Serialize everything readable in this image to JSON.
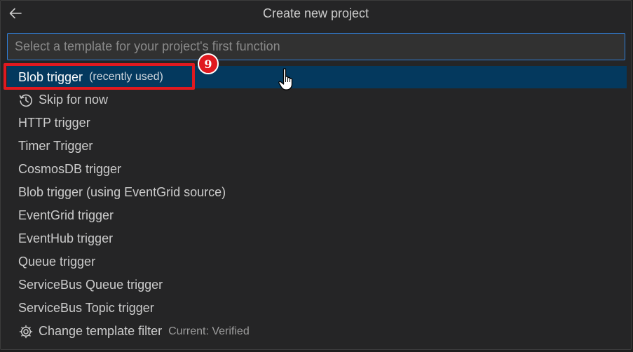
{
  "header": {
    "title": "Create new project"
  },
  "search": {
    "placeholder": "Select a template for your project's first function"
  },
  "items": [
    {
      "label": "Blob trigger",
      "desc": "(recently used)"
    },
    {
      "label": "Skip for now",
      "icon": "history-icon"
    },
    {
      "label": "HTTP trigger"
    },
    {
      "label": "Timer Trigger"
    },
    {
      "label": "CosmosDB trigger"
    },
    {
      "label": "Blob trigger (using EventGrid source)"
    },
    {
      "label": "EventGrid trigger"
    },
    {
      "label": "EventHub trigger"
    },
    {
      "label": "Queue trigger"
    },
    {
      "label": "ServiceBus Queue trigger"
    },
    {
      "label": "ServiceBus Topic trigger"
    },
    {
      "label": "Change template filter",
      "desc": "Current: Verified",
      "icon": "gear-icon"
    }
  ],
  "annotation": {
    "step": "9"
  },
  "colors": {
    "selection": "#04395e",
    "focus_border": "#2f7ed8",
    "annotation_red": "#e0191f"
  }
}
